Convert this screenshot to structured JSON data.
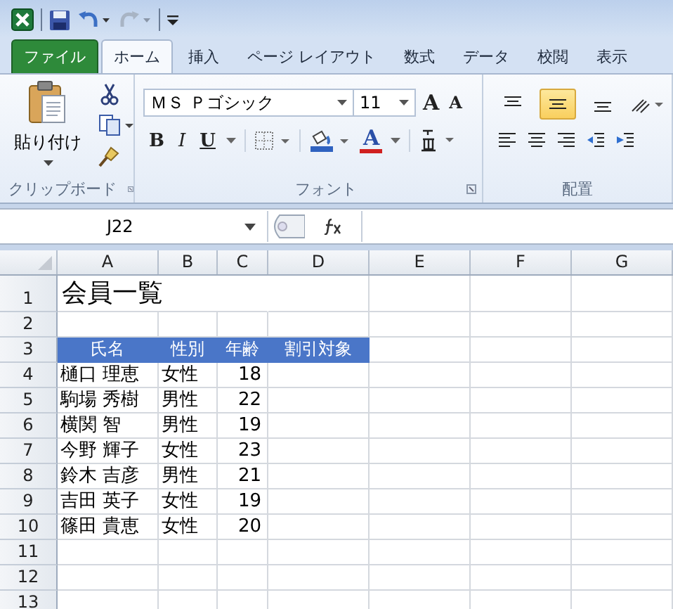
{
  "tabs": [
    {
      "label": "ファイル",
      "kind": "file",
      "selected": false
    },
    {
      "label": "ホーム",
      "kind": "tab",
      "selected": true
    },
    {
      "label": "挿入",
      "kind": "tab",
      "selected": false
    },
    {
      "label": "ページ レイアウト",
      "kind": "tab",
      "selected": false
    },
    {
      "label": "数式",
      "kind": "tab",
      "selected": false
    },
    {
      "label": "データ",
      "kind": "tab",
      "selected": false
    },
    {
      "label": "校閲",
      "kind": "tab",
      "selected": false
    },
    {
      "label": "表示",
      "kind": "tab",
      "selected": false
    }
  ],
  "ribbon": {
    "clipboard": {
      "label": "クリップボード",
      "paste_label": "貼り付け"
    },
    "font": {
      "label": "フォント",
      "font_name": "ＭＳ Ｐゴシック",
      "font_size": "11",
      "grow": "A",
      "shrink": "A",
      "bold": "B",
      "italic": "I",
      "underline": "U",
      "font_color": "A"
    },
    "alignment": {
      "label": "配置",
      "vertical": [
        {
          "kind": "top",
          "selected": false
        },
        {
          "kind": "middle",
          "selected": true
        },
        {
          "kind": "bottom",
          "selected": false
        }
      ]
    }
  },
  "formula_bar": {
    "name_box": "J22"
  },
  "sheet": {
    "columns": [
      "A",
      "B",
      "C",
      "D",
      "E",
      "F",
      "G"
    ],
    "rows": [
      {
        "number": "1",
        "cells": [
          {
            "kind": "title",
            "text": "会員一覧"
          }
        ]
      },
      {
        "number": "2",
        "cells": []
      },
      {
        "number": "3",
        "cells": [
          {
            "kind": "header",
            "text": "氏名"
          },
          {
            "kind": "header",
            "text": "性別"
          },
          {
            "kind": "header",
            "text": "年齢"
          },
          {
            "kind": "header",
            "text": "割引対象"
          }
        ]
      },
      {
        "number": "4",
        "cells": [
          {
            "kind": "text",
            "text": "樋口 理恵"
          },
          {
            "kind": "text",
            "text": "女性"
          },
          {
            "kind": "number",
            "text": "18"
          }
        ]
      },
      {
        "number": "5",
        "cells": [
          {
            "kind": "text",
            "text": "駒場 秀樹"
          },
          {
            "kind": "text",
            "text": "男性"
          },
          {
            "kind": "number",
            "text": "22"
          }
        ]
      },
      {
        "number": "6",
        "cells": [
          {
            "kind": "text",
            "text": "横関 智"
          },
          {
            "kind": "text",
            "text": "男性"
          },
          {
            "kind": "number",
            "text": "19"
          }
        ]
      },
      {
        "number": "7",
        "cells": [
          {
            "kind": "text",
            "text": "今野 輝子"
          },
          {
            "kind": "text",
            "text": "女性"
          },
          {
            "kind": "number",
            "text": "23"
          }
        ]
      },
      {
        "number": "8",
        "cells": [
          {
            "kind": "text",
            "text": "鈴木 吉彦"
          },
          {
            "kind": "text",
            "text": "男性"
          },
          {
            "kind": "number",
            "text": "21"
          }
        ]
      },
      {
        "number": "9",
        "cells": [
          {
            "kind": "text",
            "text": "吉田 英子"
          },
          {
            "kind": "text",
            "text": "女性"
          },
          {
            "kind": "number",
            "text": "19"
          }
        ]
      },
      {
        "number": "10",
        "cells": [
          {
            "kind": "text",
            "text": "篠田 貴恵"
          },
          {
            "kind": "text",
            "text": "女性"
          },
          {
            "kind": "number",
            "text": "20"
          }
        ]
      },
      {
        "number": "11",
        "cells": []
      },
      {
        "number": "12",
        "cells": []
      },
      {
        "number": "13",
        "cells": []
      }
    ]
  }
}
